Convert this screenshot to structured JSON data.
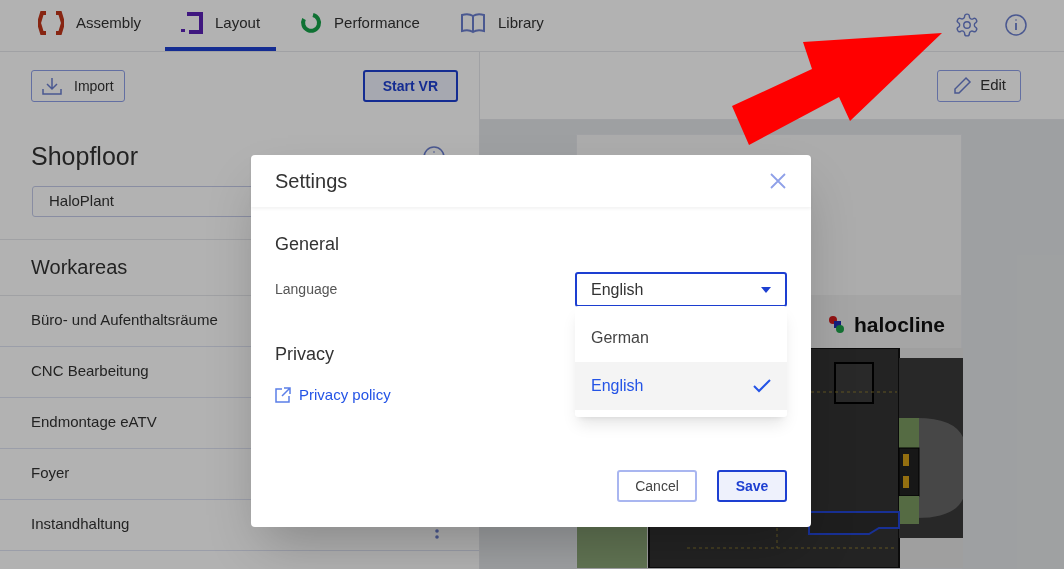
{
  "nav": {
    "tabs": [
      {
        "label": "Assembly",
        "selected": false,
        "kind": "assembly"
      },
      {
        "label": "Layout",
        "selected": true,
        "kind": "layout"
      },
      {
        "label": "Performance",
        "selected": false,
        "kind": "performance"
      },
      {
        "label": "Library",
        "selected": false,
        "kind": "library"
      }
    ]
  },
  "left_panel": {
    "import": "Import",
    "start_vr": "Start VR",
    "title": "Shopfloor",
    "plant_select": {
      "value": "HaloPlant"
    },
    "section_title": "Workareas",
    "workareas": [
      {
        "name": "Büro- und Aufenthaltsräume"
      },
      {
        "name": "CNC Bearbeitung"
      },
      {
        "name": "Endmontage eATV"
      },
      {
        "name": "Foyer"
      },
      {
        "name": "Instandhaltung",
        "menu": true
      }
    ]
  },
  "map": {
    "edit": "Edit",
    "logo": "halocline"
  },
  "dialog": {
    "title": "Settings",
    "general": "General",
    "language_label": "Language",
    "language_select": {
      "value": "English",
      "expanded": true
    },
    "options": [
      {
        "label": "German",
        "selected": false
      },
      {
        "label": "English",
        "selected": true
      }
    ],
    "privacy": "Privacy",
    "privacy_link": "Privacy policy",
    "buttons": [
      {
        "label": "Cancel",
        "kind": "secondary"
      },
      {
        "label": "Save",
        "kind": "primary"
      }
    ]
  },
  "annotation": {
    "kind": "arrow"
  }
}
